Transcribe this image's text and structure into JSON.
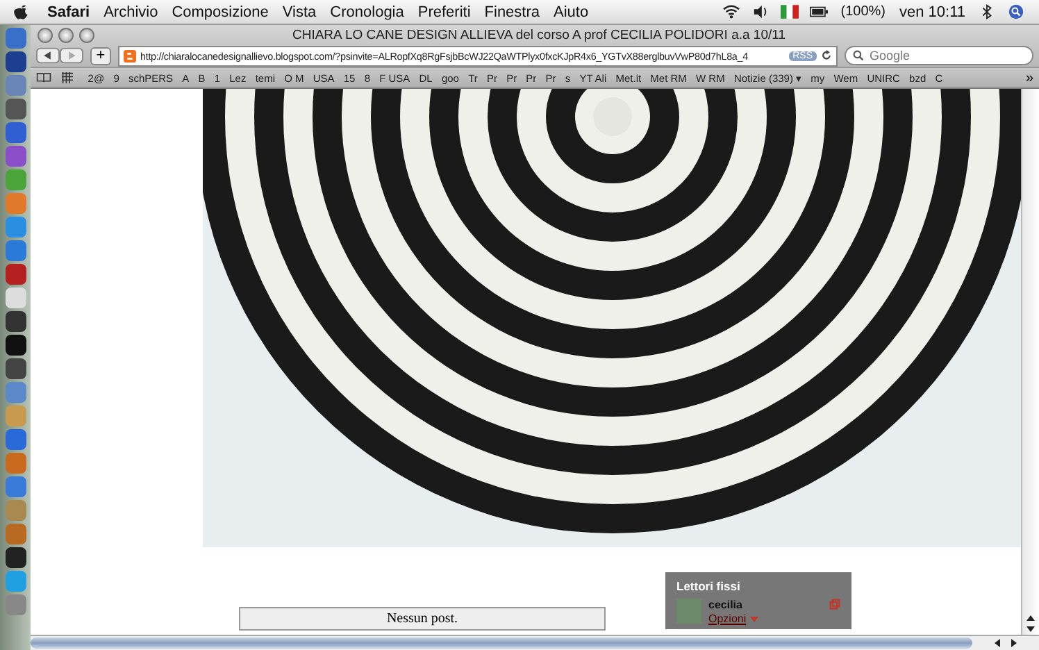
{
  "menu_bar": {
    "app": "Safari",
    "items": [
      "Archivio",
      "Composizione",
      "Vista",
      "Cronologia",
      "Preferiti",
      "Finestra",
      "Aiuto"
    ],
    "battery": "(100%)",
    "clock": "ven 10:11"
  },
  "window": {
    "title": "CHIARA LO CANE DESIGN ALLIEVA del corso A prof CECILIA POLIDORI a.a 10/11"
  },
  "toolbar": {
    "add": "+",
    "url": "http://chiaralocanedesignallievo.blogspot.com/?psinvite=ALRopfXq8RgFsjbBcWJ22QaWTPlyx0fxcKJpR4x6_YGTvX88erglbuvVwP80d7hL8a_4",
    "rss": "RSS",
    "search_placeholder": "Google"
  },
  "bookmarks": [
    "2@",
    "9",
    "schPERS",
    "A",
    "B",
    "1",
    "Lez",
    "temi",
    "O M",
    "USA",
    "15",
    "8",
    "F USA",
    "DL",
    "goo",
    "Tr",
    "Pr",
    "Pr",
    "Pr",
    "Pr",
    "s",
    "YT Ali",
    "Met.it",
    "Met RM",
    "W RM",
    "Notizie (339) ▾",
    "my",
    "Wem",
    "UNIRC",
    "bzd",
    "C"
  ],
  "bookmarks_more": "»",
  "page": {
    "empty_message": "Nessun post."
  },
  "followers": {
    "title": "Lettori fissi",
    "user": "cecilia",
    "options": "Opzioni"
  },
  "dock": {
    "apps": [
      {
        "color": "#3a6fc9"
      },
      {
        "color": "#1d3f8f"
      },
      {
        "color": "#6a86b8"
      },
      {
        "color": "#555555"
      },
      {
        "color": "#2f5fd0"
      },
      {
        "color": "#8a4fc8"
      },
      {
        "color": "#4aa43a"
      },
      {
        "color": "#e07a2a"
      },
      {
        "color": "#2a8fe0"
      },
      {
        "color": "#2a7ad8"
      },
      {
        "color": "#b52020"
      },
      {
        "color": "#dddddd"
      },
      {
        "color": "#333333"
      },
      {
        "color": "#111111"
      },
      {
        "color": "#444444"
      },
      {
        "color": "#5a88c8"
      },
      {
        "color": "#c89a50"
      },
      {
        "color": "#2a6ad8"
      },
      {
        "color": "#c86a20"
      },
      {
        "color": "#3a7ad8"
      },
      {
        "color": "#a88a50"
      },
      {
        "color": "#b86a20"
      },
      {
        "color": "#222222"
      },
      {
        "color": "#20a0e0"
      },
      {
        "color": "#888888"
      }
    ]
  }
}
